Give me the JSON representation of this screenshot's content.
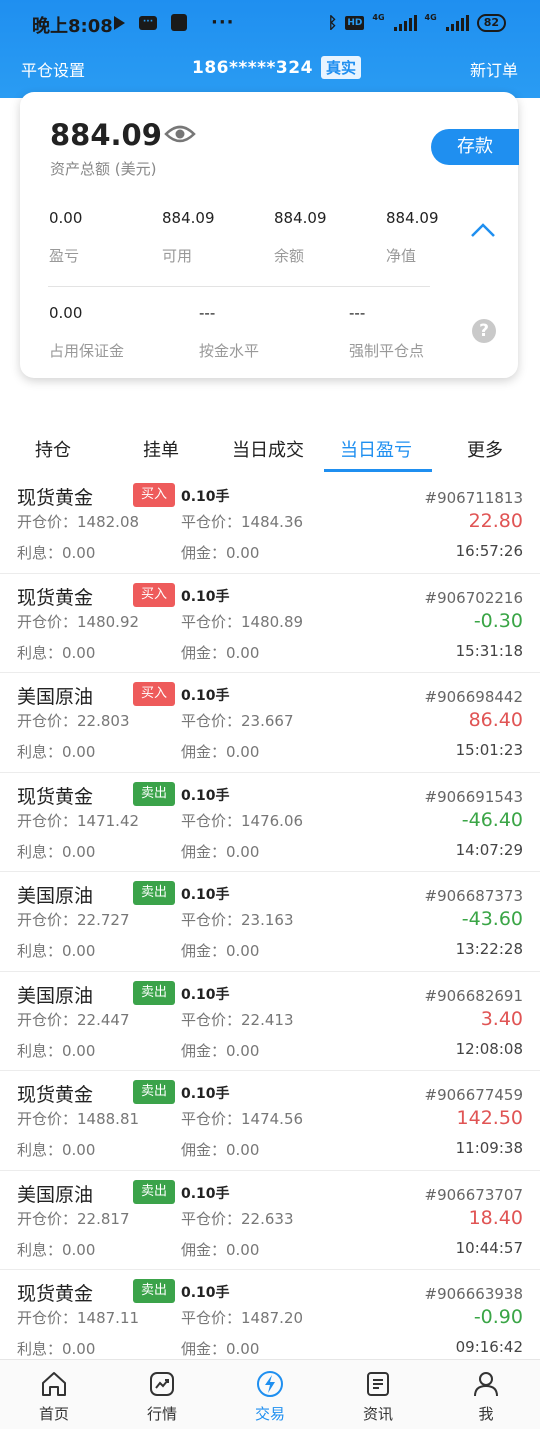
{
  "statusbar": {
    "time": "晚上8:08",
    "hd_label": "HD",
    "network_1": "4G",
    "network_2": "4G",
    "battery": "82"
  },
  "header": {
    "left_label": "平仓设置",
    "phone": "186*****324",
    "account_badge": "真实",
    "right_label": "新订单"
  },
  "account": {
    "total_value": "884.09",
    "total_label": "资产总额 (美元)",
    "deposit_label": "存款",
    "stats_row1": [
      {
        "value": "0.00",
        "label": "盈亏"
      },
      {
        "value": "884.09",
        "label": "可用"
      },
      {
        "value": "884.09",
        "label": "余额"
      },
      {
        "value": "884.09",
        "label": "净值"
      }
    ],
    "stats_row2": [
      {
        "value": "0.00",
        "label": "占用保证金"
      },
      {
        "value": "---",
        "label": "按金水平"
      },
      {
        "value": "---",
        "label": "强制平仓点"
      }
    ],
    "help_glyph": "?"
  },
  "tabs": [
    {
      "label": "持仓",
      "active": false
    },
    {
      "label": "挂单",
      "active": false
    },
    {
      "label": "当日成交",
      "active": false
    },
    {
      "label": "当日盈亏",
      "active": true
    },
    {
      "label": "更多",
      "active": false
    }
  ],
  "orders": [
    {
      "name": "现货黄金",
      "side": "买入",
      "side_type": "buy",
      "lot": "0.10手",
      "open": "开仓价：1482.08",
      "close": "平仓价：1484.36",
      "interest": "利息：0.00",
      "commission": "佣金：0.00",
      "id": "#906711813",
      "pnl": "22.80",
      "pnl_sign": "pos",
      "time": "16:57:26"
    },
    {
      "name": "现货黄金",
      "side": "买入",
      "side_type": "buy",
      "lot": "0.10手",
      "open": "开仓价：1480.92",
      "close": "平仓价：1480.89",
      "interest": "利息：0.00",
      "commission": "佣金：0.00",
      "id": "#906702216",
      "pnl": "-0.30",
      "pnl_sign": "neg",
      "time": "15:31:18"
    },
    {
      "name": "美国原油",
      "side": "买入",
      "side_type": "buy",
      "lot": "0.10手",
      "open": "开仓价：22.803",
      "close": "平仓价：23.667",
      "interest": "利息：0.00",
      "commission": "佣金：0.00",
      "id": "#906698442",
      "pnl": "86.40",
      "pnl_sign": "pos",
      "time": "15:01:23"
    },
    {
      "name": "现货黄金",
      "side": "卖出",
      "side_type": "sell",
      "lot": "0.10手",
      "open": "开仓价：1471.42",
      "close": "平仓价：1476.06",
      "interest": "利息：0.00",
      "commission": "佣金：0.00",
      "id": "#906691543",
      "pnl": "-46.40",
      "pnl_sign": "neg",
      "time": "14:07:29"
    },
    {
      "name": "美国原油",
      "side": "卖出",
      "side_type": "sell",
      "lot": "0.10手",
      "open": "开仓价：22.727",
      "close": "平仓价：23.163",
      "interest": "利息：0.00",
      "commission": "佣金：0.00",
      "id": "#906687373",
      "pnl": "-43.60",
      "pnl_sign": "neg",
      "time": "13:22:28"
    },
    {
      "name": "美国原油",
      "side": "卖出",
      "side_type": "sell",
      "lot": "0.10手",
      "open": "开仓价：22.447",
      "close": "平仓价：22.413",
      "interest": "利息：0.00",
      "commission": "佣金：0.00",
      "id": "#906682691",
      "pnl": "3.40",
      "pnl_sign": "pos",
      "time": "12:08:08"
    },
    {
      "name": "现货黄金",
      "side": "卖出",
      "side_type": "sell",
      "lot": "0.10手",
      "open": "开仓价：1488.81",
      "close": "平仓价：1474.56",
      "interest": "利息：0.00",
      "commission": "佣金：0.00",
      "id": "#906677459",
      "pnl": "142.50",
      "pnl_sign": "pos",
      "time": "11:09:38"
    },
    {
      "name": "美国原油",
      "side": "卖出",
      "side_type": "sell",
      "lot": "0.10手",
      "open": "开仓价：22.817",
      "close": "平仓价：22.633",
      "interest": "利息：0.00",
      "commission": "佣金：0.00",
      "id": "#906673707",
      "pnl": "18.40",
      "pnl_sign": "pos",
      "time": "10:44:57"
    },
    {
      "name": "现货黄金",
      "side": "卖出",
      "side_type": "sell",
      "lot": "0.10手",
      "open": "开仓价：1487.11",
      "close": "平仓价：1487.20",
      "interest": "利息：0.00",
      "commission": "佣金：0.00",
      "id": "#906663938",
      "pnl": "-0.90",
      "pnl_sign": "neg",
      "time": "09:16:42"
    }
  ],
  "bottom_nav": [
    {
      "label": "首页",
      "icon": "home-icon",
      "active": false
    },
    {
      "label": "行情",
      "icon": "market-chart-icon",
      "active": false
    },
    {
      "label": "交易",
      "icon": "trade-lightning-icon",
      "active": true
    },
    {
      "label": "资讯",
      "icon": "news-document-icon",
      "active": false
    },
    {
      "label": "我",
      "icon": "user-profile-icon",
      "active": false
    }
  ],
  "colors": {
    "brand_blue": "#1f8ff0",
    "buy_red": "#ee5b5b",
    "sell_green": "#3ba34a",
    "profit_red": "#e05454",
    "loss_green": "#3aa546"
  }
}
